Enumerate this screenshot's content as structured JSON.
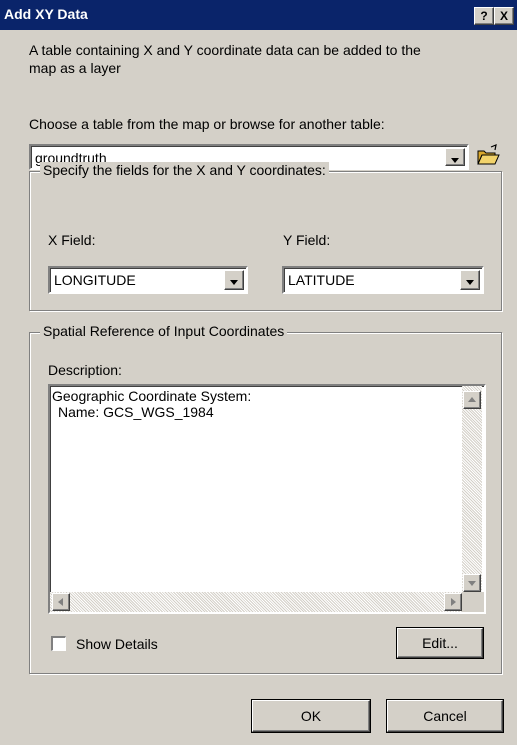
{
  "window": {
    "title": "Add XY Data",
    "help_label": "?",
    "close_label": "X"
  },
  "intro": {
    "line1": "A table containing X and Y coordinate data can be added to the",
    "line2": "map as a layer"
  },
  "table": {
    "prompt": "Choose a table from the map or browse for another table:",
    "selected": "groundtruth"
  },
  "fields_group": {
    "legend": "Specify the fields for the X and Y coordinates:",
    "x_label": "X Field:",
    "x_value": "LONGITUDE",
    "y_label": "Y Field:",
    "y_value": "LATITUDE"
  },
  "spatial_group": {
    "legend": "Spatial Reference of Input Coordinates",
    "description_label": "Description:",
    "description_line1": "Geographic Coordinate System:",
    "description_line2": "Name: GCS_WGS_1984",
    "show_details_label": "Show Details",
    "show_details_checked": false,
    "edit_label": "Edit..."
  },
  "footer": {
    "ok_label": "OK",
    "cancel_label": "Cancel"
  },
  "colors": {
    "titlebar": "#0a246a",
    "face": "#d4d0c8",
    "field": "#ffffff"
  },
  "icons": {
    "browse": "open-folder-icon"
  }
}
